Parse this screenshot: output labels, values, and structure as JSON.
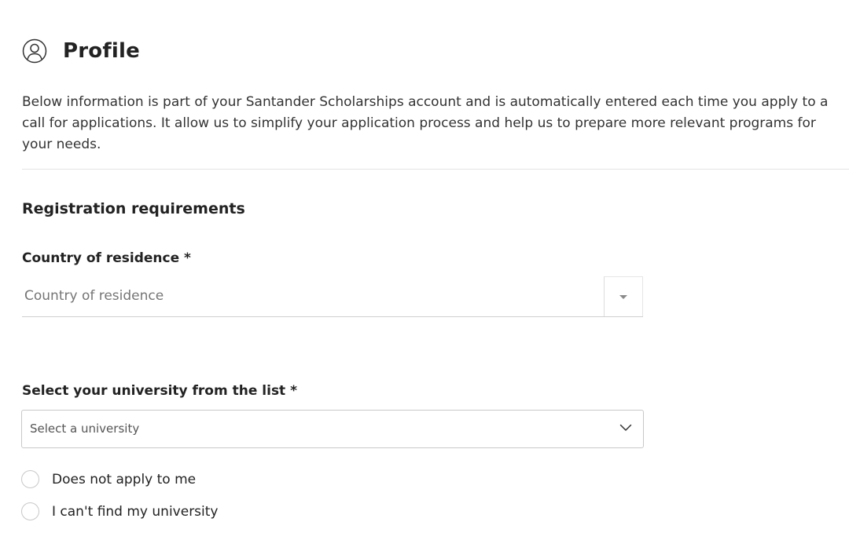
{
  "header": {
    "title": "Profile",
    "icon": "user-circle-icon"
  },
  "intro": {
    "text": "Below information is part of your Santander Scholarships account and is automatically entered each time you apply to a call for applications. It allow us to simplify your application process and help us to prepare more relevant programs for your needs."
  },
  "section": {
    "title": "Registration requirements"
  },
  "country": {
    "label": "Country of residence *",
    "placeholder": "Country of residence",
    "icon": "caret-down-icon"
  },
  "university": {
    "label": "Select your university from the list *",
    "placeholder": "Select a university",
    "icon": "chevron-down-icon",
    "options": [
      {
        "label": "Does not apply to me",
        "checked": false
      },
      {
        "label": "I can't find my university",
        "checked": false
      }
    ]
  }
}
